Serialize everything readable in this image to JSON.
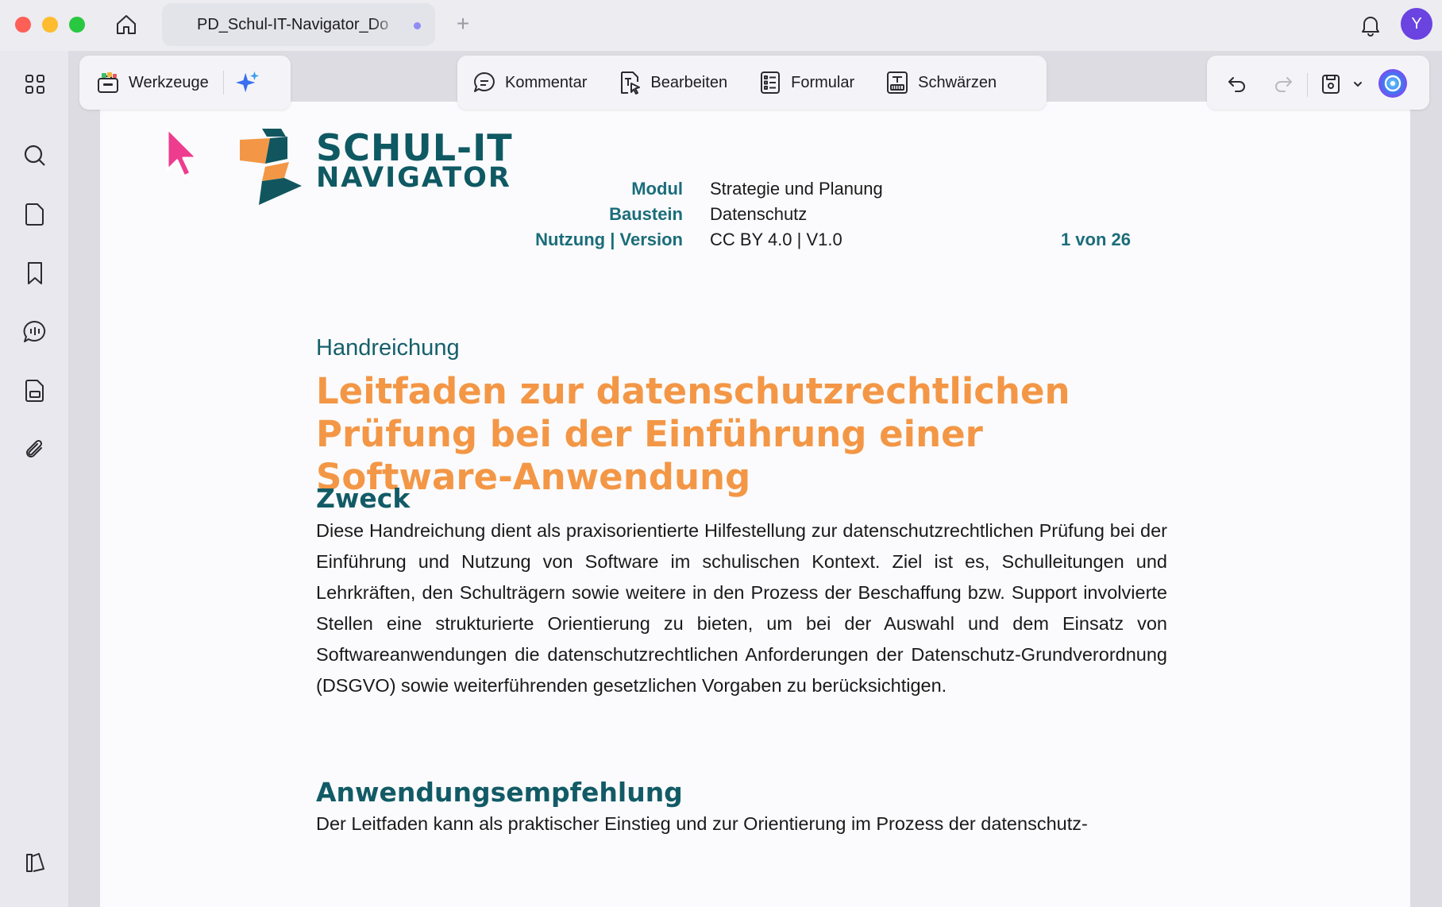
{
  "window": {
    "tab_title": "PD_Schul-IT-Navigator_Do",
    "avatar_initial": "Y"
  },
  "toolbar": {
    "tools_label": "Werkzeuge",
    "comment_label": "Kommentar",
    "edit_label": "Bearbeiten",
    "form_label": "Formular",
    "redact_label": "Schwärzen"
  },
  "sidebar": {
    "items": [
      "grid-icon",
      "search-icon",
      "page-icon",
      "bookmark-icon",
      "comments-icon",
      "form-icon",
      "attachment-icon",
      "layout-icon"
    ]
  },
  "document": {
    "brand_line1": "SCHUL-IT",
    "brand_line2": "NAVIGATOR",
    "meta": [
      {
        "label": "Modul",
        "value": "Strategie und Planung"
      },
      {
        "label": "Baustein",
        "value": "Datenschutz"
      },
      {
        "label": "Nutzung | Version",
        "value": "CC BY 4.0 | V1.0"
      }
    ],
    "page_indicator": "1 von 26",
    "kicker": "Handreichung",
    "title": "Leitfaden zur datenschutzrechtlichen Prüfung bei der Einführung einer Software-Anwendung",
    "section1_heading": "Zweck",
    "section1_body": "Diese Handreichung dient als praxisorientierte Hilfestellung zur datenschutzrechtlichen Prü­fung bei der Einführung und Nutzung von Software im schulischen Kontext. Ziel ist es, Schul­leitungen und Lehrkräften, den Schulträgern sowie weitere in den Prozess der Beschaffung bzw. Support involvierte Stellen eine strukturierte Orientierung zu bieten, um bei der Auswahl und dem Einsatz von Softwareanwendungen die datenschutzrechtlichen Anforderungen der Datenschutz-Grundverordnung (DSGVO) sowie weiterführenden gesetzlichen Vorgaben zu berücksichtigen.",
    "section2_heading": "Anwendungsempfehlung",
    "section2_body": "Der Leitfaden kann als praktischer Einstieg und zur Orientierung im Prozess der datenschutz-"
  },
  "colors": {
    "accent_teal": "#1b6d7a",
    "title_orange": "#f39746",
    "brand_dark": "#0f5963"
  }
}
